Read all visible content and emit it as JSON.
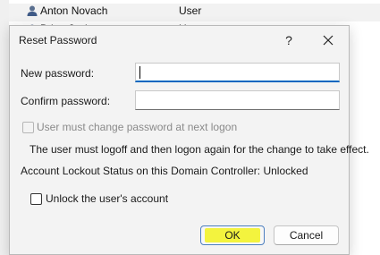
{
  "background": {
    "row1": {
      "name": "Anton Novach",
      "type": "User"
    },
    "row2": {
      "name": "Brian Jack",
      "type": "User"
    }
  },
  "dialog": {
    "title": "Reset Password",
    "help_label": "?",
    "new_password_label": "New password:",
    "new_password_value": "",
    "confirm_password_label": "Confirm password:",
    "confirm_password_value": "",
    "must_change_label": "User must change password at next logon",
    "info_text": "The user must logoff and then logon again for the change to take effect.",
    "lockout_status": "Account Lockout Status on this Domain Controller: Unlocked",
    "unlock_label": "Unlock the user's account",
    "ok_label": "OK",
    "cancel_label": "Cancel"
  },
  "colors": {
    "ok_highlight": "#f2f200",
    "focus_accent": "#0067c0"
  }
}
